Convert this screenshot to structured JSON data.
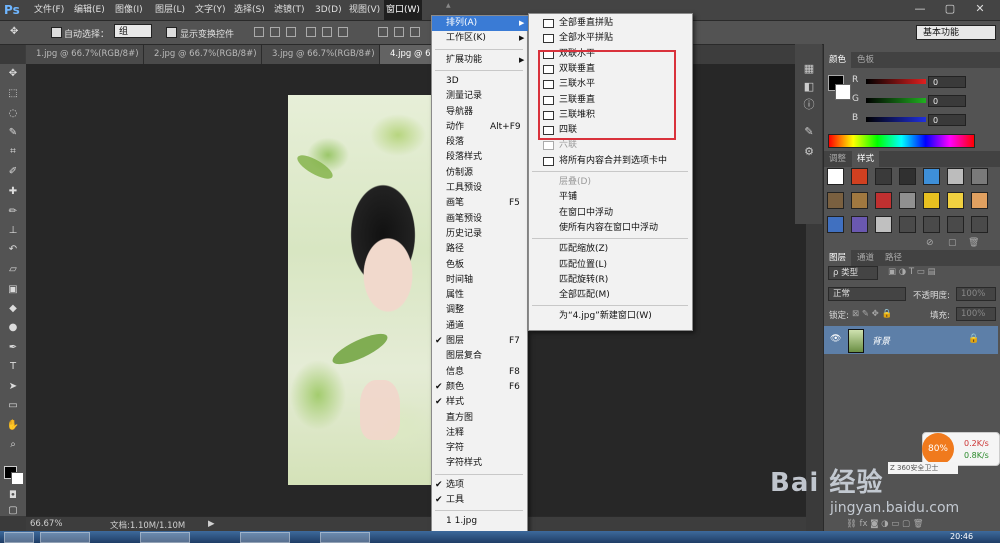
{
  "app": {
    "logo": "Ps"
  },
  "menubar": {
    "items": [
      "文件(F)",
      "编辑(E)",
      "图像(I)",
      "图层(L)",
      "文字(Y)",
      "选择(S)",
      "滤镜(T)",
      "3D(D)",
      "视图(V)",
      "窗口(W)"
    ],
    "active": "窗口(W)"
  },
  "window_controls": {
    "minimize": "—",
    "restore": "▢",
    "close": "✕"
  },
  "options_bar": {
    "auto_select_label": "自动选择：",
    "auto_select_value": "组",
    "show_transform_label": "显示变换控件",
    "workspace": "基本功能"
  },
  "doc_tabs": [
    "1.jpg @ 66.7%(RGB/8#)",
    "2.jpg @ 66.7%(RGB/8#)",
    "3.jpg @ 66.7%(RGB/8#)",
    "4.jpg @ 66.7%(RGB/8#)"
  ],
  "active_tab_index": 3,
  "status": {
    "zoom": "66.67%",
    "doc": "文档:1.10M/1.10M"
  },
  "window_menu": {
    "items": [
      {
        "label": "排列(A)",
        "submenu": true,
        "highlighted": true
      },
      {
        "label": "工作区(K)",
        "submenu": true
      },
      {
        "sep": true
      },
      {
        "label": "扩展功能",
        "submenu": true
      },
      {
        "sep": true
      },
      {
        "label": "3D"
      },
      {
        "label": "测量记录"
      },
      {
        "label": "导航器"
      },
      {
        "label": "动作",
        "shortcut": "Alt+F9"
      },
      {
        "label": "段落"
      },
      {
        "label": "段落样式"
      },
      {
        "label": "仿制源"
      },
      {
        "label": "工具预设"
      },
      {
        "label": "画笔",
        "shortcut": "F5"
      },
      {
        "label": "画笔预设"
      },
      {
        "label": "历史记录"
      },
      {
        "label": "路径"
      },
      {
        "label": "色板"
      },
      {
        "label": "时间轴"
      },
      {
        "label": "属性"
      },
      {
        "label": "调整"
      },
      {
        "label": "通道"
      },
      {
        "label": "图层",
        "shortcut": "F7",
        "checked": true
      },
      {
        "label": "图层复合"
      },
      {
        "label": "信息",
        "shortcut": "F8"
      },
      {
        "label": "颜色",
        "shortcut": "F6",
        "checked": true
      },
      {
        "label": "样式",
        "checked": true
      },
      {
        "label": "直方图"
      },
      {
        "label": "注释"
      },
      {
        "label": "字符"
      },
      {
        "label": "字符样式"
      },
      {
        "sep": true
      },
      {
        "label": "选项",
        "checked": true
      },
      {
        "label": "工具",
        "checked": true
      },
      {
        "sep": true
      },
      {
        "label": "1 1.jpg"
      }
    ],
    "more_arrow": "▼"
  },
  "arrange_menu": {
    "items": [
      {
        "label": "全部垂直拼贴",
        "icon": "tile-vertical-icon"
      },
      {
        "label": "全部水平拼贴",
        "icon": "tile-horizontal-icon"
      },
      {
        "label": "双联水平",
        "icon": "two-up-horizontal-icon"
      },
      {
        "label": "双联垂直",
        "icon": "two-up-vertical-icon"
      },
      {
        "label": "三联水平",
        "icon": "three-up-horizontal-icon"
      },
      {
        "label": "三联垂直",
        "icon": "three-up-vertical-icon"
      },
      {
        "label": "三联堆积",
        "icon": "three-up-stacked-icon"
      },
      {
        "label": "四联",
        "icon": "four-up-icon"
      },
      {
        "label": "六联",
        "icon": "six-up-icon",
        "disabled": true
      },
      {
        "label": "将所有内容合并到选项卡中",
        "icon": "consolidate-tabs-icon"
      },
      {
        "sep": true
      },
      {
        "label": "层叠(D)",
        "disabled": true
      },
      {
        "label": "平铺"
      },
      {
        "label": "在窗口中浮动"
      },
      {
        "label": "使所有内容在窗口中浮动"
      },
      {
        "sep": true
      },
      {
        "label": "匹配缩放(Z)"
      },
      {
        "label": "匹配位置(L)"
      },
      {
        "label": "匹配旋转(R)"
      },
      {
        "label": "全部匹配(M)"
      },
      {
        "sep": true
      },
      {
        "label": "为“4.jpg”新建窗口(W)"
      }
    ]
  },
  "color_panel": {
    "tabs": [
      "颜色",
      "色板"
    ],
    "channels": [
      {
        "name": "R",
        "value": "0",
        "color": "#e02020"
      },
      {
        "name": "G",
        "value": "0",
        "color": "#20b020"
      },
      {
        "name": "B",
        "value": "0",
        "color": "#2030e0"
      }
    ]
  },
  "styles_panel": {
    "tabs": [
      "调整",
      "样式"
    ],
    "swatches": [
      "#ffffff",
      "#d04020",
      "#3a3a3a",
      "#303030",
      "#3e8fd8",
      "#bcbcbc",
      "#7a7a7a",
      "#7a6040",
      "#a07840",
      "#c03030",
      "#909090",
      "#e8c020",
      "#f0d040",
      "#e0a060",
      "#4070c0",
      "#6a58b0",
      "#c0c0c0",
      "#4a4a4a",
      "#4a4a4a",
      "#4a4a4a",
      "#4a4a4a"
    ]
  },
  "layers_panel": {
    "tabs": [
      "图层",
      "通道",
      "路径"
    ],
    "filter_label": "ρ 类型",
    "blend_mode": "正常",
    "opacity_label": "不透明度:",
    "opacity_value": "100%",
    "lock_label": "锁定:",
    "fill_label": "填充:",
    "fill_value": "100%",
    "layer_name": "背景"
  },
  "net_widget": {
    "percent": "80%",
    "up": "0.2K/s",
    "down": "0.8K/s",
    "badge": "Z 360安全卫士"
  },
  "watermark": {
    "logo": "Bai 经验",
    "url": "jingyan.baidu.com"
  },
  "clock": "20:46"
}
